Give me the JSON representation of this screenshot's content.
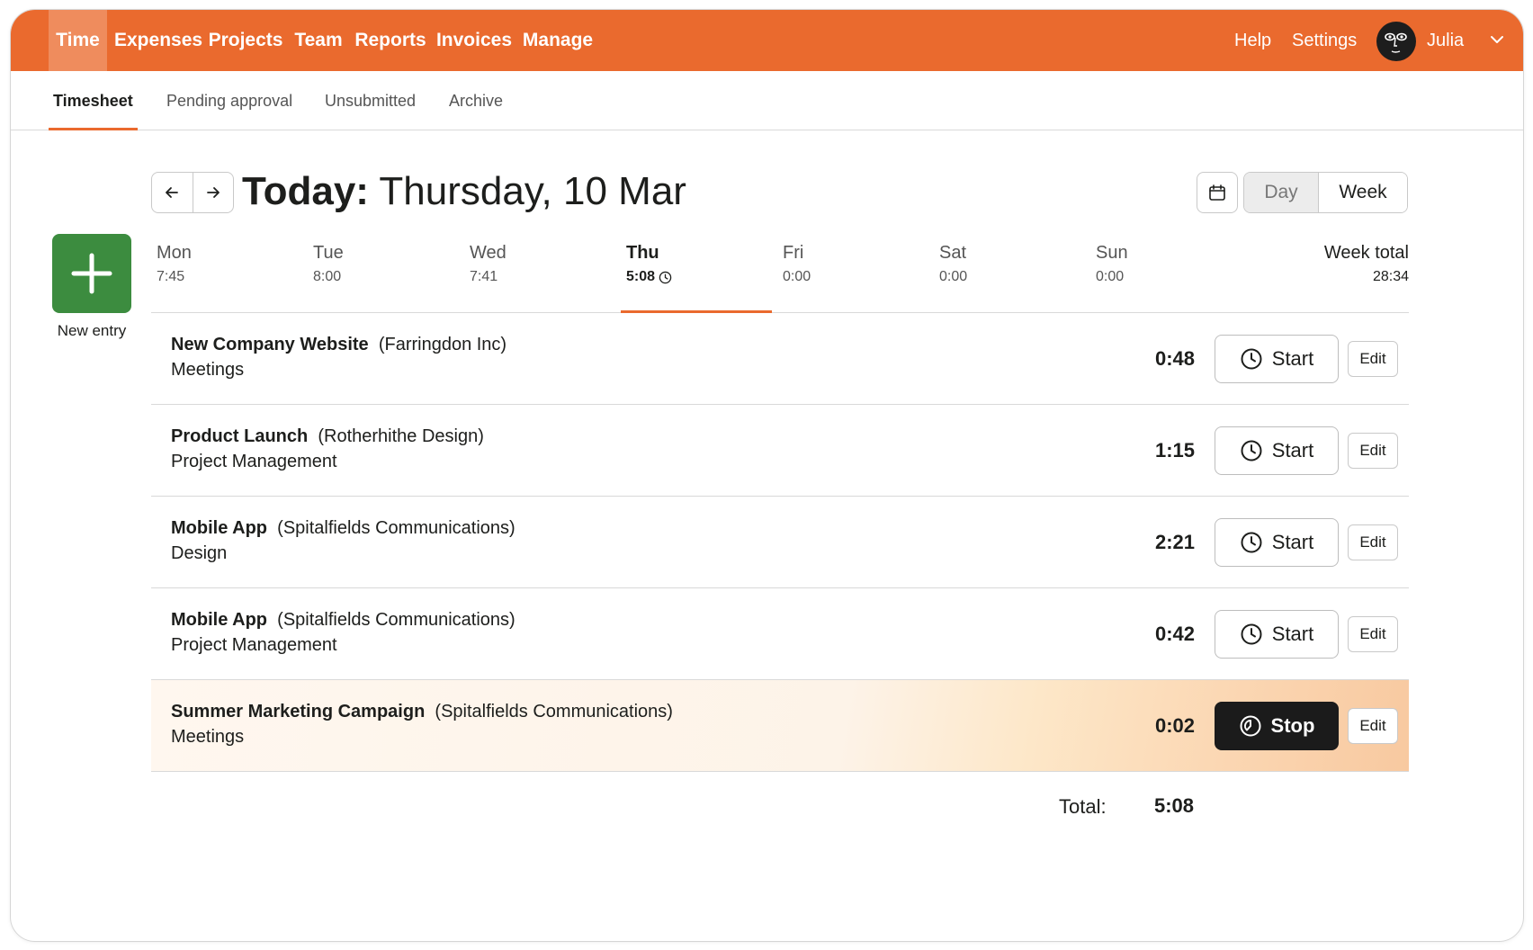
{
  "nav": {
    "items": [
      {
        "label": "Time",
        "active": true
      },
      {
        "label": "Expenses"
      },
      {
        "label": "Projects"
      },
      {
        "label": "Team"
      },
      {
        "label": "Reports"
      },
      {
        "label": "Invoices"
      },
      {
        "label": "Manage"
      }
    ],
    "help": "Help",
    "settings": "Settings",
    "user": "Julia"
  },
  "subtabs": [
    {
      "label": "Timesheet",
      "active": true
    },
    {
      "label": "Pending approval"
    },
    {
      "label": "Unsubmitted"
    },
    {
      "label": "Archive"
    }
  ],
  "header": {
    "title_prefix": "Today:",
    "title_date": "Thursday, 10 Mar",
    "view_day": "Day",
    "view_week": "Week",
    "selected_view": "Day"
  },
  "new_entry": {
    "label": "New entry"
  },
  "days": [
    {
      "name": "Mon",
      "hours": "7:45"
    },
    {
      "name": "Tue",
      "hours": "8:00"
    },
    {
      "name": "Wed",
      "hours": "7:41"
    },
    {
      "name": "Thu",
      "hours": "5:08",
      "active": true,
      "running": true
    },
    {
      "name": "Fri",
      "hours": "0:00"
    },
    {
      "name": "Sat",
      "hours": "0:00"
    },
    {
      "name": "Sun",
      "hours": "0:00"
    }
  ],
  "week_total": {
    "label": "Week total",
    "value": "28:34"
  },
  "entries": [
    {
      "project": "New Company Website",
      "client": "(Farringdon Inc)",
      "task": "Meetings",
      "duration": "0:48",
      "action": "Start",
      "edit": "Edit"
    },
    {
      "project": "Product Launch",
      "client": "(Rotherhithe Design)",
      "task": "Project Management",
      "duration": "1:15",
      "action": "Start",
      "edit": "Edit"
    },
    {
      "project": "Mobile App",
      "client": "(Spitalfields Communications)",
      "task": "Design",
      "duration": "2:21",
      "action": "Start",
      "edit": "Edit"
    },
    {
      "project": "Mobile App",
      "client": "(Spitalfields Communications)",
      "task": "Project Management",
      "duration": "0:42",
      "action": "Start",
      "edit": "Edit"
    },
    {
      "project": "Summer Marketing Campaign",
      "client": "(Spitalfields Communications)",
      "task": "Meetings",
      "duration": "0:02",
      "action": "Stop",
      "edit": "Edit",
      "running": true
    }
  ],
  "total": {
    "label": "Total:",
    "value": "5:08"
  },
  "colors": {
    "brand": "#ea6a2e",
    "new_entry": "#3c8c3f",
    "stop_button": "#1b1b1b"
  }
}
